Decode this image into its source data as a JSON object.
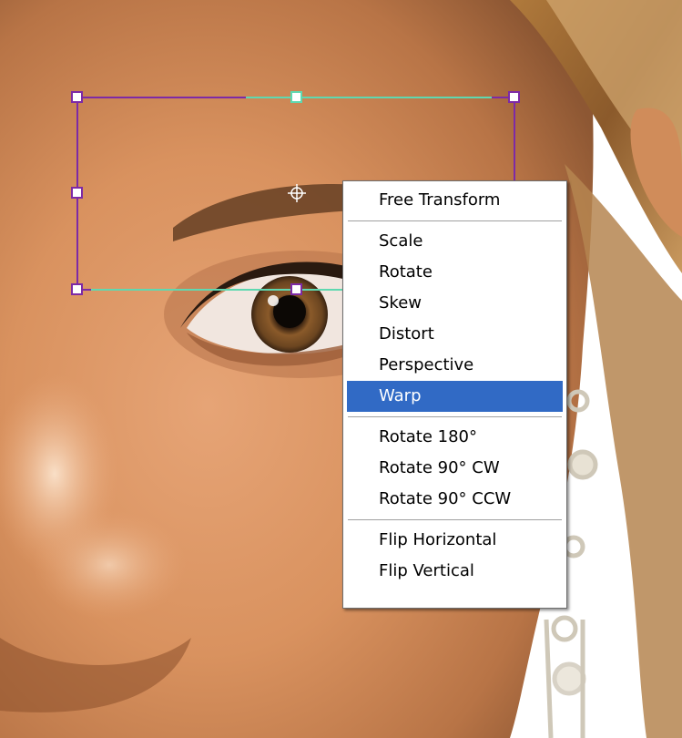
{
  "context_menu": {
    "items": [
      {
        "label": "Free Transform",
        "selected": false
      },
      {
        "separator": true
      },
      {
        "label": "Scale",
        "selected": false
      },
      {
        "label": "Rotate",
        "selected": false
      },
      {
        "label": "Skew",
        "selected": false
      },
      {
        "label": "Distort",
        "selected": false
      },
      {
        "label": "Perspective",
        "selected": false
      },
      {
        "label": "Warp",
        "selected": true
      },
      {
        "separator": true
      },
      {
        "label": "Rotate 180°",
        "selected": false
      },
      {
        "label": "Rotate 90° CW",
        "selected": false
      },
      {
        "label": "Rotate 90° CCW",
        "selected": false
      },
      {
        "separator": true
      },
      {
        "label": "Flip Horizontal",
        "selected": false
      },
      {
        "label": "Flip Vertical",
        "selected": false
      }
    ]
  },
  "colors": {
    "transform_box": "#7d2aa6",
    "transform_box_highlight": "#5fd8b0",
    "menu_highlight": "#316ac5"
  }
}
